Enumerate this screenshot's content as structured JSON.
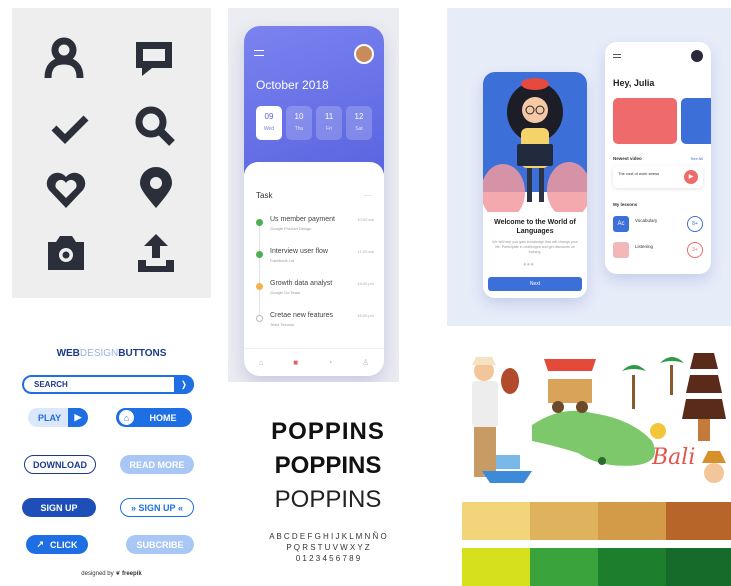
{
  "calendar_app": {
    "month": "October 2018",
    "days": [
      {
        "num": "09",
        "dow": "Wed"
      },
      {
        "num": "10",
        "dow": "Thu"
      },
      {
        "num": "11",
        "dow": "Fri"
      },
      {
        "num": "12",
        "dow": "Sat"
      }
    ],
    "task_heading": "Task",
    "tasks": [
      {
        "name": "Us member payment",
        "sub": "Google Product Design",
        "time": "10:00 am",
        "color": "#4caf50"
      },
      {
        "name": "Interview user flow",
        "sub": "Facebook Ltd",
        "time": "11:00 am",
        "color": "#4caf50"
      },
      {
        "name": "Growth data analyst",
        "sub": "Google Go Team",
        "time": "14:00 pm",
        "color": "#f2b34c"
      },
      {
        "name": "Cretae new features",
        "sub": "Tesla Tecnolo",
        "time": "16:00 pm",
        "color": "#cccccc"
      }
    ]
  },
  "language_app": {
    "welcome_title": "Welcome to the World of Languages",
    "welcome_body": "We will help you gain knowledge that will change your life. Participate in challenges and get discounts on training.",
    "next_label": "Next",
    "greeting": "Hey, Julia",
    "newest_label": "Newest video",
    "see_all": "See All",
    "video_title": "The cost of work stress",
    "lessons_label": "My lessons",
    "lessons": [
      {
        "name": "Vocabulary",
        "badge": "8+"
      },
      {
        "name": "Listening",
        "badge": "3+"
      }
    ]
  },
  "buttons_panel": {
    "title_web": "WEB",
    "title_design": "DESIGN",
    "title_buttons": "BUTTONS",
    "search": "SEARCH",
    "play": "PLAY",
    "home": "HOME",
    "download": "DOWNLOAD",
    "read_more": "READ MORE",
    "sign_up": "SIGN UP",
    "sign_up_2": "SIGN UP",
    "click": "CLICK",
    "subscribe": "SUBCRIBE",
    "credit": "designed by",
    "brand": "freepik"
  },
  "typography": {
    "line1": "POPPINS",
    "line2": "POPPINS",
    "line3": "POPPINS",
    "alpha1": "A B C D E F G H I J K L M N Ñ O",
    "alpha2": "P Q R S T U V W X Y Z",
    "digits": "0 1 2 3 4 5 6 7 8 9"
  },
  "bali": {
    "label": "Bali"
  },
  "swatches": {
    "row1": [
      "#f2d57a",
      "#dfb35e",
      "#d39b47",
      "#b8652a"
    ],
    "row2": [
      "#d6e01c",
      "#3aa33c",
      "#1d7f2d",
      "#176b2a"
    ]
  },
  "icon_colors": {
    "icon": "#2b2f3a",
    "accent": "#5a62d8",
    "button_blue": "#1e6fe3"
  }
}
